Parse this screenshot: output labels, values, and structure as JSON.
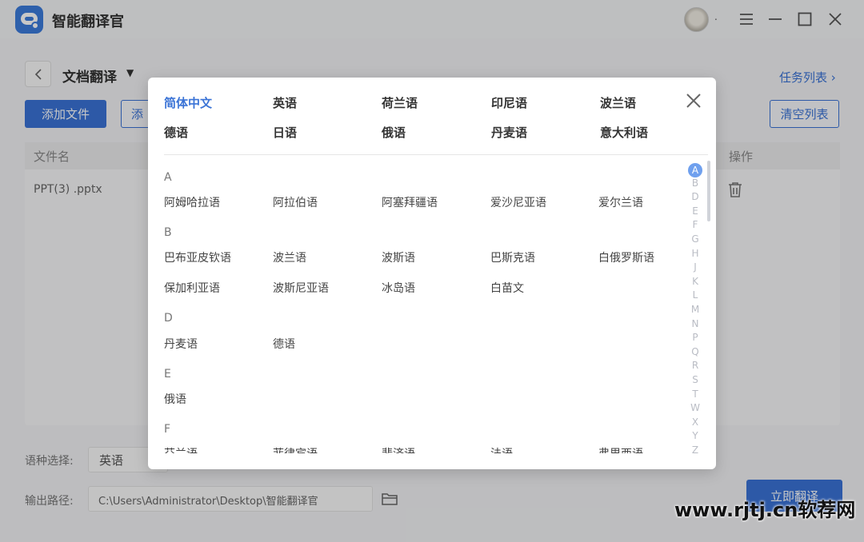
{
  "app": {
    "title": "智能翻译官",
    "avatar_dot": "."
  },
  "page": {
    "title": "文档翻译",
    "task_list": "任务列表 ›",
    "add_file": "添加文件",
    "add_folder": "添",
    "clear_list": "清空列表",
    "col_file": "文件名",
    "col_op": "操作",
    "rows": [
      {
        "file": "PPT(3) .pptx"
      }
    ],
    "lang_label": "语种选择:",
    "lang_value": "英语",
    "path_label": "输出路径:",
    "path_value": "C:\\Users\\Administrator\\Desktop\\智能翻译官",
    "translate_btn": "立即翻译"
  },
  "modal": {
    "favorites": [
      "简体中文",
      "英语",
      "荷兰语",
      "印尼语",
      "波兰语",
      "德语",
      "日语",
      "俄语",
      "丹麦语",
      "意大利语"
    ],
    "active_favorite": "简体中文",
    "sections": [
      {
        "letter": "A",
        "langs": [
          "阿姆哈拉语",
          "阿拉伯语",
          "阿塞拜疆语",
          "爱沙尼亚语",
          "爱尔兰语"
        ]
      },
      {
        "letter": "B",
        "langs": [
          "巴布亚皮钦语",
          "波兰语",
          "波斯语",
          "巴斯克语",
          "白俄罗斯语",
          "保加利亚语",
          "波斯尼亚语",
          "冰岛语",
          "白苗文"
        ]
      },
      {
        "letter": "D",
        "langs": [
          "丹麦语",
          "德语"
        ]
      },
      {
        "letter": "E",
        "langs": [
          "俄语"
        ]
      },
      {
        "letter": "F",
        "langs": [
          "芬兰语",
          "菲律宾语",
          "斐济语",
          "法语",
          "弗里西语"
        ]
      }
    ],
    "alphabet": [
      "A",
      "B",
      "D",
      "E",
      "F",
      "G",
      "H",
      "J",
      "K",
      "L",
      "M",
      "N",
      "P",
      "Q",
      "R",
      "S",
      "T",
      "W",
      "X",
      "Y",
      "Z"
    ],
    "active_letter": "A"
  },
  "watermark": "www.rjtj.cn软荐网",
  "colors": {
    "accent": "#3a73d6",
    "alpha_active": "#6fa0ee"
  }
}
